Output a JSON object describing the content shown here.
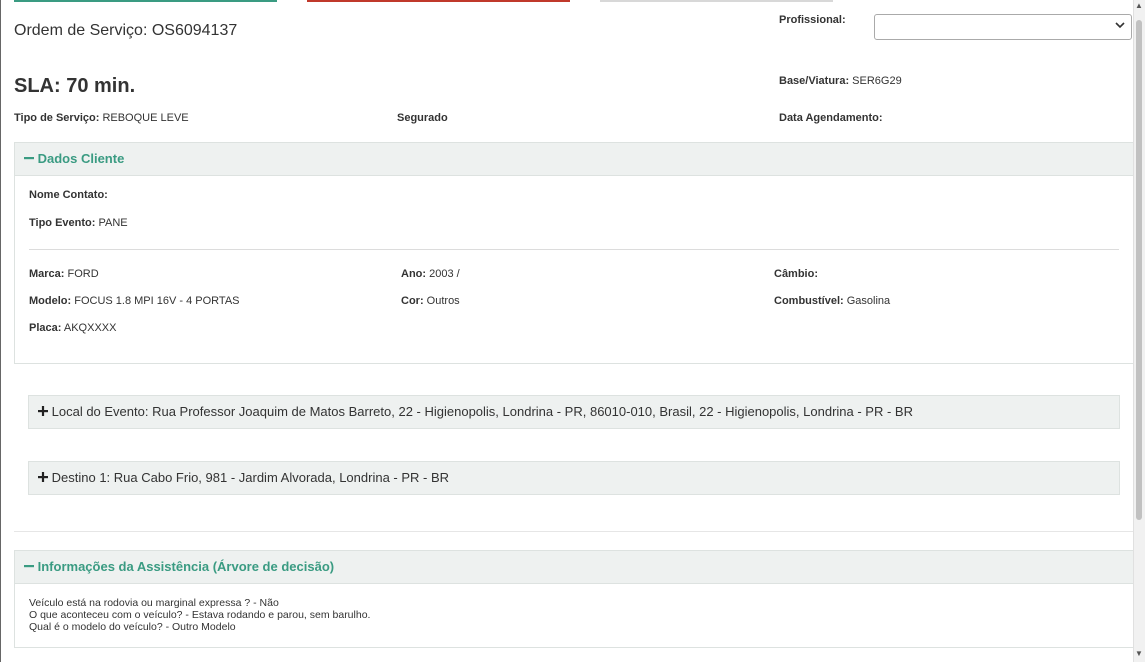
{
  "header": {
    "os_title": "Ordem de Serviço: OS6094137",
    "sla": "SLA: 70 min.",
    "profissional_label": "Profissional:",
    "profissional_value": "",
    "base_label": "Base/Viatura:",
    "base_value": "SER6G29",
    "tipo_servico_label": "Tipo de Serviço:",
    "tipo_servico_value": "REBOQUE LEVE",
    "segurado_label": "Segurado",
    "data_agendamento_label": "Data Agendamento:"
  },
  "dados_cliente": {
    "title": "Dados Cliente",
    "nome_contato_label": "Nome Contato:",
    "tipo_evento_label": "Tipo Evento:",
    "tipo_evento_value": "PANE",
    "marca_label": "Marca:",
    "marca_value": "FORD",
    "ano_label": "Ano:",
    "ano_value": "2003 /",
    "cambio_label": "Câmbio:",
    "modelo_label": "Modelo:",
    "modelo_value": "FOCUS 1.8 MPI 16V - 4 PORTAS",
    "cor_label": "Cor:",
    "cor_value": "Outros",
    "combustivel_label": "Combustível:",
    "combustivel_value": "Gasolina",
    "placa_label": "Placa:",
    "placa_value": "AKQXXXX"
  },
  "local_evento": {
    "text": "Local do Evento: Rua Professor Joaquim de Matos Barreto, 22 - Higienopolis, Londrina - PR, 86010-010, Brasil, 22 - Higienopolis, Londrina - PR - BR"
  },
  "destino": {
    "text": "Destino 1: Rua Cabo Frio, 981 - Jardim Alvorada, Londrina - PR - BR"
  },
  "assistencia": {
    "title": "Informações da Assistência (Árvore de decisão)",
    "lines": [
      "Veículo está na rodovia ou marginal expressa ? - Não",
      "O que aconteceu com o veículo? - Estava rodando e parou, sem barulho.",
      "Qual é o modelo do veículo? - Outro Modelo"
    ]
  },
  "icons": {
    "minus": "minus-icon",
    "plus": "plus-icon",
    "chevron": "chevron-down-icon"
  },
  "colors": {
    "accent": "#3a9b82",
    "tab_green": "#3a9b82",
    "tab_red": "#c0392b"
  }
}
